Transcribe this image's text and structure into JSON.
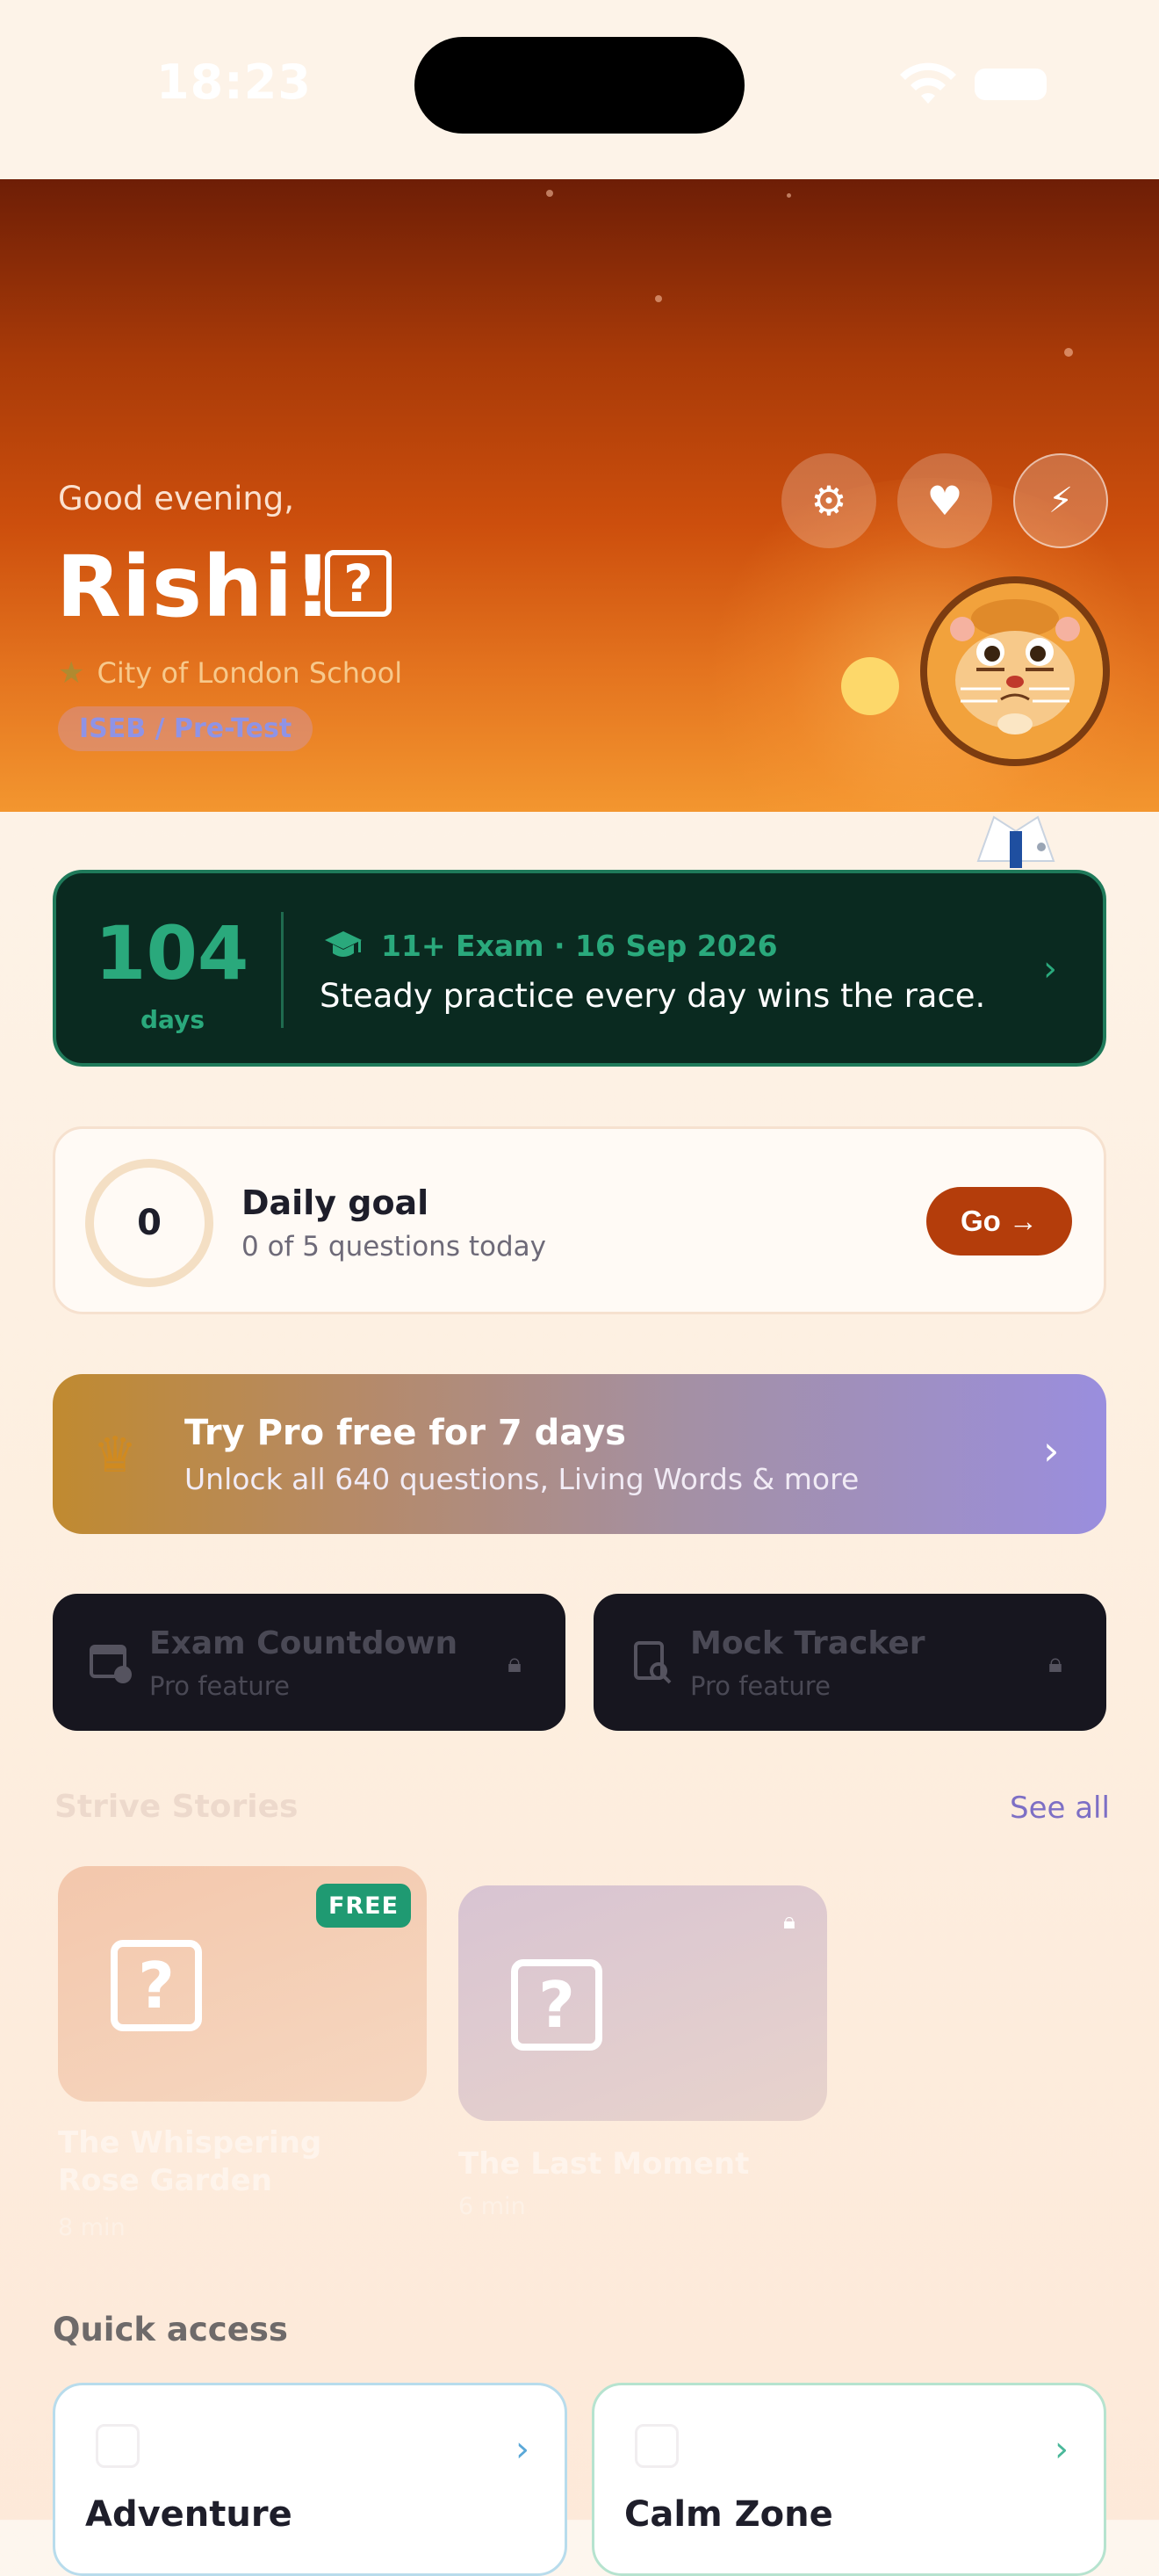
{
  "status_bar": {
    "time": "18:23"
  },
  "header": {
    "greeting": "Good evening,",
    "name": "Rishi!",
    "name_icon": "?",
    "school": "City of London School",
    "school_icon": "★",
    "exam_track": "ISEB / Pre-Test",
    "buttons": [
      {
        "name": "settings",
        "icon": "⚙"
      },
      {
        "name": "favourites",
        "icon": "♥"
      },
      {
        "name": "boost",
        "icon": "⚡"
      }
    ]
  },
  "countdown": {
    "days_number": "104",
    "days_label": "days",
    "exam_label": "11+ Exam · 16 Sep 2026",
    "message": "Steady practice every day wins the race."
  },
  "daily_goal": {
    "count": "0",
    "title": "Daily goal",
    "subtitle": "0 of 5 questions today",
    "button_label": "Go →"
  },
  "pro_banner": {
    "title": "Try Pro free for 7 days",
    "subtitle": "Unlock all 640 questions, Living Words & more"
  },
  "pro_tiles": [
    {
      "title": "Exam Countdown",
      "subtitle": "Pro feature"
    },
    {
      "title": "Mock Tracker",
      "subtitle": "Pro feature"
    }
  ],
  "stories": {
    "section_title": "Strive Stories",
    "see_all": "See all",
    "items": [
      {
        "title": "The Whispering Rose Garden",
        "meta": "8 min",
        "badge": "FREE"
      },
      {
        "title": "The Last Moment",
        "meta": "6 min"
      }
    ]
  },
  "quick_access": {
    "title": "Quick access",
    "items": [
      {
        "label": "Adventure"
      },
      {
        "label": "Calm Zone"
      }
    ]
  },
  "colors": {
    "hero_top": "#6e1e06",
    "hero_bottom": "#f3962f",
    "countdown_bg": "#0a2a20",
    "accent_green": "#2aa97c",
    "go_button": "#b43d0b",
    "see_all": "#7d6fc5"
  }
}
